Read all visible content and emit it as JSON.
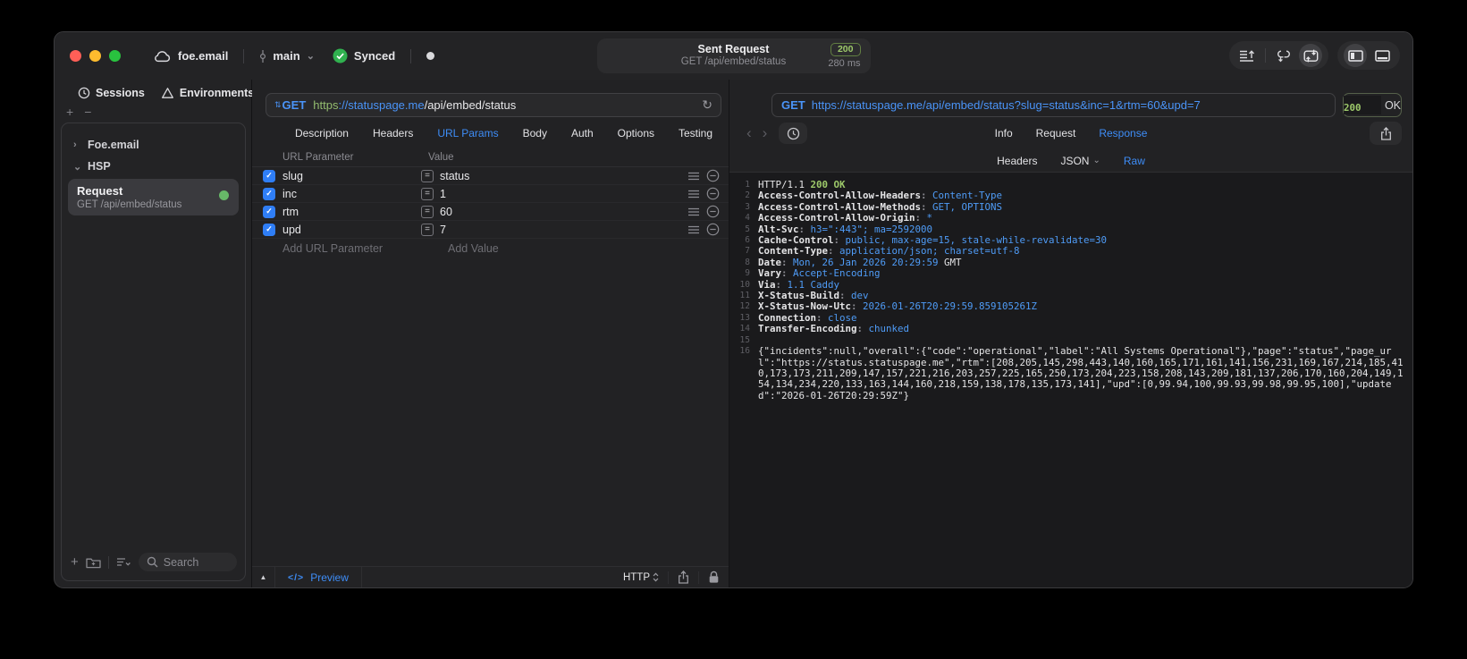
{
  "titlebar": {
    "project": "foe.email",
    "branch": "main",
    "sync_status": "Synced",
    "center": {
      "title": "Sent Request",
      "subtitle": "GET /api/embed/status",
      "status_code": "200",
      "duration": "280 ms"
    }
  },
  "sidebar": {
    "tabs": [
      {
        "label": "Sessions"
      },
      {
        "label": "Environments"
      }
    ],
    "tree": [
      {
        "label": "Foe.email"
      },
      {
        "label": "HSP"
      }
    ],
    "request_item": {
      "title": "Request",
      "subtitle": "GET /api/embed/status"
    },
    "search_placeholder": "Search"
  },
  "request_pane": {
    "method": "GET",
    "url_scheme": "https",
    "url_host": "://statuspage.me",
    "url_path": "/api/embed/status",
    "tabs": [
      "Description",
      "Headers",
      "URL Params",
      "Body",
      "Auth",
      "Options",
      "Testing"
    ],
    "active_tab": "URL Params",
    "table": {
      "headers": [
        "URL Parameter",
        "Value"
      ],
      "rows": [
        {
          "name": "slug",
          "value": "status",
          "checked": true
        },
        {
          "name": "inc",
          "value": "1",
          "checked": true
        },
        {
          "name": "rtm",
          "value": "60",
          "checked": true
        },
        {
          "name": "upd",
          "value": "7",
          "checked": true
        }
      ],
      "add_name_placeholder": "Add URL Parameter",
      "add_value_placeholder": "Add Value"
    },
    "footer": {
      "preview_label": "Preview",
      "code_icon": "</>",
      "protocol": "HTTP"
    }
  },
  "response_pane": {
    "method": "GET",
    "url": "https://statuspage.me/api/embed/status?slug=status&inc=1&rtm=60&upd=7",
    "status_code": "200",
    "status_text": "OK",
    "tabs": [
      "Info",
      "Request",
      "Response"
    ],
    "active_tab": "Response",
    "subtabs": [
      "Headers",
      "JSON",
      "Raw"
    ],
    "active_subtab": "Raw",
    "json_subtab_has_dropdown": true,
    "lines": [
      {
        "n": "1",
        "parts": [
          [
            "p",
            "HTTP/1.1 "
          ],
          [
            "g",
            "200 OK"
          ]
        ]
      },
      {
        "n": "2",
        "parts": [
          [
            "h",
            "Access-Control-Allow-Headers"
          ],
          [
            "c",
            ": "
          ],
          [
            "v",
            "Content-Type"
          ]
        ]
      },
      {
        "n": "3",
        "parts": [
          [
            "h",
            "Access-Control-Allow-Methods"
          ],
          [
            "c",
            ": "
          ],
          [
            "v",
            "GET, OPTIONS"
          ]
        ]
      },
      {
        "n": "4",
        "parts": [
          [
            "h",
            "Access-Control-Allow-Origin"
          ],
          [
            "c",
            ": "
          ],
          [
            "v",
            "*"
          ]
        ]
      },
      {
        "n": "5",
        "parts": [
          [
            "h",
            "Alt-Svc"
          ],
          [
            "c",
            ": "
          ],
          [
            "v",
            "h3=\":443\"; ma=2592000"
          ]
        ]
      },
      {
        "n": "6",
        "parts": [
          [
            "h",
            "Cache-Control"
          ],
          [
            "c",
            ": "
          ],
          [
            "v",
            "public, max-age=15, stale-while-revalidate=30"
          ]
        ]
      },
      {
        "n": "7",
        "parts": [
          [
            "h",
            "Content-Type"
          ],
          [
            "c",
            ": "
          ],
          [
            "v",
            "application/json; charset=utf-8"
          ]
        ]
      },
      {
        "n": "8",
        "parts": [
          [
            "h",
            "Date"
          ],
          [
            "c",
            ": "
          ],
          [
            "v",
            "Mon, 26 Jan 2026 20:29:59"
          ],
          [
            "p",
            " GMT"
          ]
        ]
      },
      {
        "n": "9",
        "parts": [
          [
            "h",
            "Vary"
          ],
          [
            "c",
            ": "
          ],
          [
            "v",
            "Accept-Encoding"
          ]
        ]
      },
      {
        "n": "10",
        "parts": [
          [
            "h",
            "Via"
          ],
          [
            "c",
            ": "
          ],
          [
            "v",
            "1.1 Caddy"
          ]
        ]
      },
      {
        "n": "11",
        "parts": [
          [
            "h",
            "X-Status-Build"
          ],
          [
            "c",
            ": "
          ],
          [
            "v",
            "dev"
          ]
        ]
      },
      {
        "n": "12",
        "parts": [
          [
            "h",
            "X-Status-Now-Utc"
          ],
          [
            "c",
            ": "
          ],
          [
            "v",
            "2026-01-26T20:29:59.859105261Z"
          ]
        ]
      },
      {
        "n": "13",
        "parts": [
          [
            "h",
            "Connection"
          ],
          [
            "c",
            ": "
          ],
          [
            "v",
            "close"
          ]
        ]
      },
      {
        "n": "14",
        "parts": [
          [
            "h",
            "Transfer-Encoding"
          ],
          [
            "c",
            ": "
          ],
          [
            "v",
            "chunked"
          ]
        ]
      },
      {
        "n": "15",
        "parts": []
      },
      {
        "n": "16",
        "wrap": true,
        "parts": [
          [
            "p",
            "{\"incidents\":null,\"overall\":{\"code\":\"operational\",\"label\":\"All Systems Operational\"},\"page\":\"status\",\"page_url\":\"https://status.statuspage.me\",\"rtm\":[208,205,145,298,443,140,160,165,171,161,141,156,231,169,167,214,185,410,173,173,211,209,147,157,221,216,203,257,225,165,250,173,204,223,158,208,143,209,181,137,206,170,160,204,149,154,134,234,220,133,163,144,160,218,159,138,178,135,173,141],\"upd\":[0,99.94,100,99.93,99.98,99.95,100],\"updated\":\"2026-01-26T20:29:59Z\"}"
          ]
        ]
      }
    ]
  },
  "colors": {
    "accent_blue": "#3e8df7",
    "status_green": "#9dc96a",
    "checkbox_blue": "#2f7ef6",
    "indicator_green": "#67b868"
  }
}
